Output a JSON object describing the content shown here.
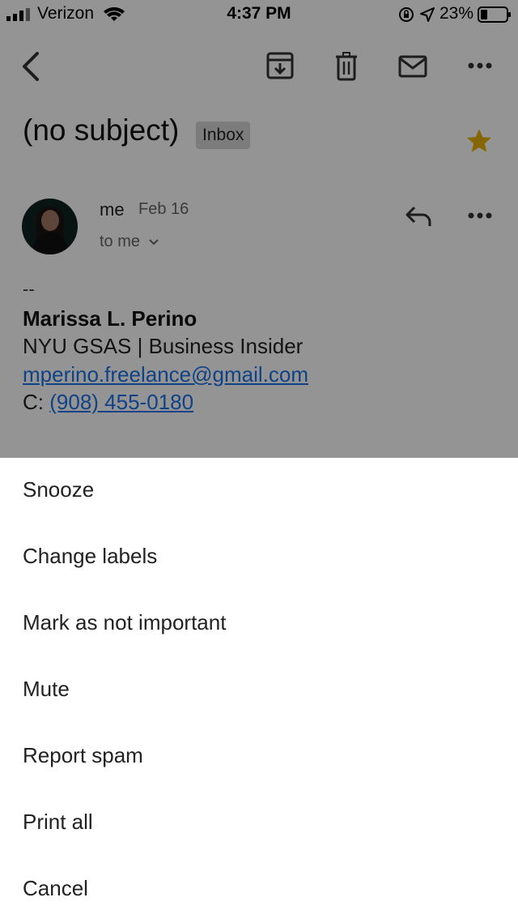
{
  "status_bar": {
    "carrier": "Verizon",
    "time": "4:37 PM",
    "battery": "23%"
  },
  "toolbar": {
    "icons": [
      "back-icon",
      "archive-icon",
      "delete-icon",
      "mark-unread-icon",
      "more-icon"
    ]
  },
  "email": {
    "subject": "(no subject)",
    "label": "Inbox",
    "starred": true,
    "star_color": "#e8b000",
    "sender": "me",
    "date": "Feb 16",
    "recipient": "to me",
    "signature": {
      "dash": "--",
      "name": "Marissa L. Perino",
      "org": "NYU GSAS | Business Insider",
      "email": "mperino.freelance@gmail.com",
      "phone_prefix": "C:",
      "phone": "(908) 455-0180"
    }
  },
  "menu": {
    "items": [
      "Snooze",
      "Change labels",
      "Mark as not important",
      "Mute",
      "Report spam",
      "Print all",
      "Cancel"
    ]
  },
  "colors": {
    "link": "#1a73e8",
    "overlay": "rgba(0,0,0,0.42)"
  }
}
